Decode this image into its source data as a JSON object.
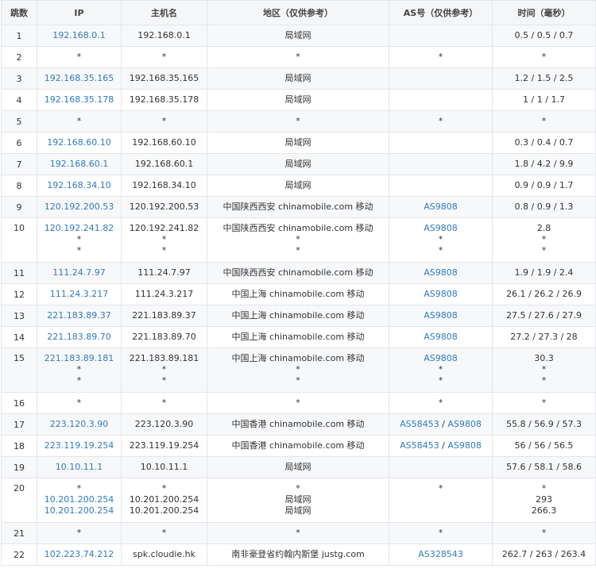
{
  "headers": [
    "跳数",
    "IP",
    "主机名",
    "地区（仅供参考）",
    "AS号（仅供参考）",
    "时间（毫秒）"
  ],
  "rows": [
    {
      "hop": "1",
      "ip": [
        "192.168.0.1"
      ],
      "host": [
        "192.168.0.1"
      ],
      "region": [
        "局域网"
      ],
      "as": [
        []
      ],
      "time": [
        "0.5 / 0.5 / 0.7"
      ]
    },
    {
      "hop": "2",
      "ip": [
        "*"
      ],
      "host": [
        "*"
      ],
      "region": [
        "*"
      ],
      "as": [
        [
          "*"
        ]
      ],
      "time": [
        "*"
      ]
    },
    {
      "hop": "3",
      "ip": [
        "192.168.35.165"
      ],
      "host": [
        "192.168.35.165"
      ],
      "region": [
        "局域网"
      ],
      "as": [
        []
      ],
      "time": [
        "1.2 / 1.5 / 2.5"
      ]
    },
    {
      "hop": "4",
      "ip": [
        "192.168.35.178"
      ],
      "host": [
        "192.168.35.178"
      ],
      "region": [
        "局域网"
      ],
      "as": [
        []
      ],
      "time": [
        "1 / 1 / 1.7"
      ]
    },
    {
      "hop": "5",
      "ip": [
        "*"
      ],
      "host": [
        "*"
      ],
      "region": [
        "*"
      ],
      "as": [
        [
          "*"
        ]
      ],
      "time": [
        "*"
      ]
    },
    {
      "hop": "6",
      "ip": [
        "192.168.60.10"
      ],
      "host": [
        "192.168.60.10"
      ],
      "region": [
        "局域网"
      ],
      "as": [
        []
      ],
      "time": [
        "0.3 / 0.4 / 0.7"
      ]
    },
    {
      "hop": "7",
      "ip": [
        "192.168.60.1"
      ],
      "host": [
        "192.168.60.1"
      ],
      "region": [
        "局域网"
      ],
      "as": [
        []
      ],
      "time": [
        "1.8 / 4.2 / 9.9"
      ]
    },
    {
      "hop": "8",
      "ip": [
        "192.168.34.10"
      ],
      "host": [
        "192.168.34.10"
      ],
      "region": [
        "局域网"
      ],
      "as": [
        []
      ],
      "time": [
        "0.9 / 0.9 / 1.7"
      ]
    },
    {
      "hop": "9",
      "ip": [
        "120.192.200.53"
      ],
      "host": [
        "120.192.200.53"
      ],
      "region": [
        "中国陕西西安 chinamobile.com 移动"
      ],
      "as": [
        [
          "AS9808"
        ]
      ],
      "time": [
        "0.8 / 0.9 / 1.3"
      ]
    },
    {
      "hop": "10",
      "ip": [
        "120.192.241.82",
        "*",
        "*"
      ],
      "host": [
        "120.192.241.82",
        "*",
        "*"
      ],
      "region": [
        "中国陕西西安 chinamobile.com 移动",
        "*",
        "*"
      ],
      "as": [
        [
          "AS9808"
        ],
        [
          "*"
        ],
        [
          "*"
        ]
      ],
      "time": [
        "2.8",
        "*",
        "*"
      ]
    },
    {
      "hop": "11",
      "ip": [
        "111.24.7.97"
      ],
      "host": [
        "111.24.7.97"
      ],
      "region": [
        "中国陕西西安 chinamobile.com 移动"
      ],
      "as": [
        [
          "AS9808"
        ]
      ],
      "time": [
        "1.9 / 1.9 / 2.4"
      ]
    },
    {
      "hop": "12",
      "ip": [
        "111.24.3.217"
      ],
      "host": [
        "111.24.3.217"
      ],
      "region": [
        "中国上海 chinamobile.com 移动"
      ],
      "as": [
        [
          "AS9808"
        ]
      ],
      "time": [
        "26.1 / 26.2 / 26.9"
      ]
    },
    {
      "hop": "13",
      "ip": [
        "221.183.89.37"
      ],
      "host": [
        "221.183.89.37"
      ],
      "region": [
        "中国上海 chinamobile.com 移动"
      ],
      "as": [
        [
          "AS9808"
        ]
      ],
      "time": [
        "27.5 / 27.6 / 27.9"
      ]
    },
    {
      "hop": "14",
      "ip": [
        "221.183.89.70"
      ],
      "host": [
        "221.183.89.70"
      ],
      "region": [
        "中国上海 chinamobile.com 移动"
      ],
      "as": [
        [
          "AS9808"
        ]
      ],
      "time": [
        "27.2 / 27.3 / 28"
      ]
    },
    {
      "hop": "15",
      "ip": [
        "221.183.89.181",
        "*",
        "*"
      ],
      "host": [
        "221.183.89.181",
        "*",
        "*"
      ],
      "region": [
        "中国上海 chinamobile.com 移动",
        "*",
        "*"
      ],
      "as": [
        [
          "AS9808"
        ],
        [
          "*"
        ],
        [
          "*"
        ]
      ],
      "time": [
        "30.3",
        "*",
        "*"
      ]
    },
    {
      "hop": "16",
      "ip": [
        "*"
      ],
      "host": [
        "*"
      ],
      "region": [
        "*"
      ],
      "as": [
        [
          "*"
        ]
      ],
      "time": [
        "*"
      ]
    },
    {
      "hop": "17",
      "ip": [
        "223.120.3.90"
      ],
      "host": [
        "223.120.3.90"
      ],
      "region": [
        "中国香港 chinamobile.com 移动"
      ],
      "as": [
        [
          "AS58453",
          "AS9808"
        ]
      ],
      "time": [
        "55.8 / 56.9 / 57.3"
      ]
    },
    {
      "hop": "18",
      "ip": [
        "223.119.19.254"
      ],
      "host": [
        "223.119.19.254"
      ],
      "region": [
        "中国香港 chinamobile.com 移动"
      ],
      "as": [
        [
          "AS58453",
          "AS9808"
        ]
      ],
      "time": [
        "56 / 56 / 56.5"
      ]
    },
    {
      "hop": "19",
      "ip": [
        "10.10.11.1"
      ],
      "host": [
        "10.10.11.1"
      ],
      "region": [
        "局域网"
      ],
      "as": [
        []
      ],
      "time": [
        "57.6 / 58.1 / 58.6"
      ]
    },
    {
      "hop": "20",
      "ip": [
        "*",
        "10.201.200.254",
        "10.201.200.254"
      ],
      "host": [
        "*",
        "10.201.200.254",
        "10.201.200.254"
      ],
      "region": [
        "*",
        "局域网",
        "局域网"
      ],
      "as": [
        [
          "*"
        ],
        [],
        []
      ],
      "time": [
        "*",
        "293",
        "266.3"
      ]
    },
    {
      "hop": "21",
      "ip": [
        "*"
      ],
      "host": [
        "*"
      ],
      "region": [
        "*"
      ],
      "as": [
        [
          "*"
        ]
      ],
      "time": [
        "*"
      ]
    },
    {
      "hop": "22",
      "ip": [
        "102.223.74.212"
      ],
      "host": [
        "spk.cloudie.hk"
      ],
      "region": [
        "南非豪登省约翰内斯堡 justg.com"
      ],
      "as": [
        [
          "AS328543"
        ]
      ],
      "time": [
        "262.7 / 263 / 263.4"
      ]
    }
  ]
}
